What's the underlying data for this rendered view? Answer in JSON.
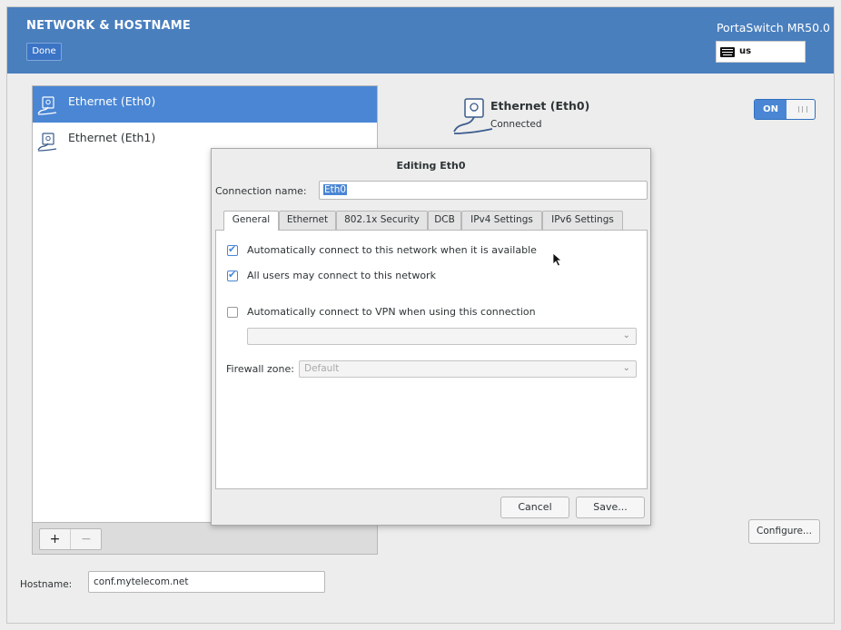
{
  "header": {
    "title": "NETWORK & HOSTNAME",
    "done_label": "Done",
    "product": "PortaSwitch MR50.0",
    "keyboard_layout": "us"
  },
  "devices": {
    "items": [
      {
        "label": "Ethernet (Eth0)",
        "selected": true
      },
      {
        "label": "Ethernet (Eth1)",
        "selected": false
      }
    ],
    "add_label": "+",
    "remove_label": "−"
  },
  "detail": {
    "name": "Ethernet (Eth0)",
    "status": "Connected",
    "switch_label": "ON",
    "configure_label": "Configure..."
  },
  "hostname": {
    "label": "Hostname:",
    "value": "conf.mytelecom.net"
  },
  "dialog": {
    "title": "Editing Eth0",
    "conn_name_label": "Connection name:",
    "conn_name_value": "Eth0",
    "tabs": [
      {
        "label": "General",
        "active": true
      },
      {
        "label": "Ethernet",
        "active": false
      },
      {
        "label": "802.1x Security",
        "active": false
      },
      {
        "label": "DCB",
        "active": false
      },
      {
        "label": "IPv4 Settings",
        "active": false
      },
      {
        "label": "IPv6 Settings",
        "active": false
      }
    ],
    "general": {
      "auto_connect_label": "Automatically connect to this network when it is available",
      "auto_connect_checked": true,
      "all_users_label": "All users may connect to this network",
      "all_users_checked": true,
      "vpn_label": "Automatically connect to VPN when using this connection",
      "vpn_checked": false,
      "vpn_select_value": "",
      "firewall_label": "Firewall zone:",
      "firewall_value": "Default"
    },
    "cancel_label": "Cancel",
    "save_label": "Save..."
  },
  "colors": {
    "header_bg": "#4a7fbe",
    "selection": "#4a86d4"
  }
}
